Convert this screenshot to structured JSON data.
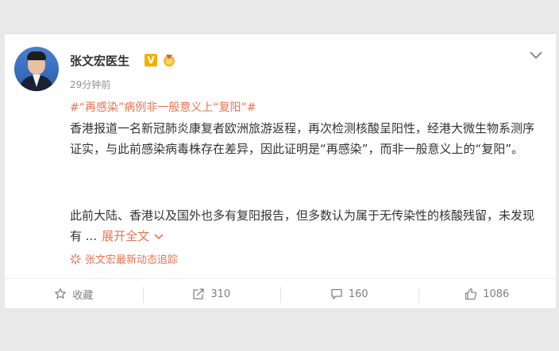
{
  "post": {
    "author": "张文宏医生",
    "verified_badge": "V",
    "timestamp": "29分钟前",
    "topic": "#“再感染”病例非一般意义上“复阳”#",
    "paragraph1": "香港报道一名新冠肺炎康复者欧洲旅游返程，再次检测核酸呈阳性，经港大微生物系测序证实，与此前感染病毒株存在差异，因此证明是“再感染”，而非一般意义上的“复阳”。",
    "paragraph2": "此前大陆、香港以及国外也多有复阳报告，但多数认为属于无传染性的核酸残留，未发现有 ...",
    "expand_label": "展开全文",
    "tracker_label": "张文宏最新动态追踪"
  },
  "toolbar": {
    "favorite_label": "收藏",
    "repost_count": "310",
    "comment_count": "160",
    "like_count": "1086"
  },
  "colors": {
    "accent": "#eb7350",
    "text": "#333333",
    "muted": "#939393",
    "badge": "#f3b000"
  },
  "icons": [
    "avatar",
    "verified-v-icon",
    "medal-icon",
    "chevron-down-icon",
    "burst-icon",
    "star-icon",
    "repost-icon",
    "comment-icon",
    "thumbs-up-icon"
  ]
}
